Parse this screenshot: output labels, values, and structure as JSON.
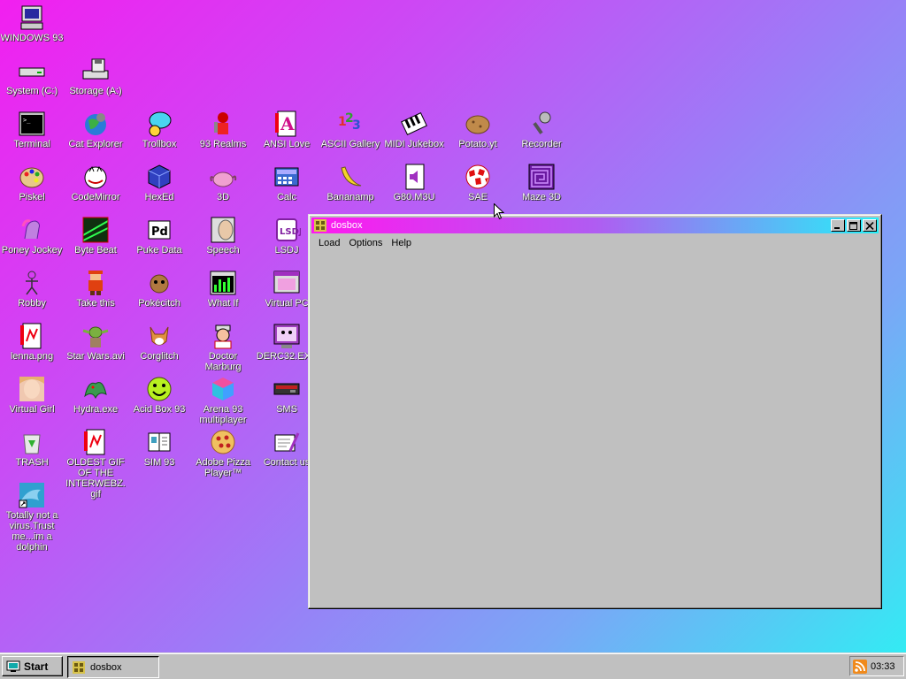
{
  "desktop_icons": [
    {
      "id": "win93",
      "label": "WINDOWS 93",
      "icon": "computer-icon"
    },
    {
      "id": "sysc",
      "label": "System (C:)",
      "icon": "hard-drive-icon"
    },
    {
      "id": "stora",
      "label": "Storage (A:)",
      "icon": "floppy-drive-icon"
    },
    {
      "id": "terminal",
      "label": "Terminal",
      "icon": "terminal-icon"
    },
    {
      "id": "catexp",
      "label": "Cat Explorer",
      "icon": "globe-cat-icon"
    },
    {
      "id": "trollbox",
      "label": "Trollbox",
      "icon": "chat-bubble-icon"
    },
    {
      "id": "realms",
      "label": "93 Realms",
      "icon": "knight-icon"
    },
    {
      "id": "ansi",
      "label": "ANSI Love",
      "icon": "letter-a-icon"
    },
    {
      "id": "ascii",
      "label": "ASCII Gallery",
      "icon": "numbers-icon"
    },
    {
      "id": "midi",
      "label": "MIDI Jukebox",
      "icon": "piano-keys-icon"
    },
    {
      "id": "potato",
      "label": "Potato.yt",
      "icon": "potato-icon"
    },
    {
      "id": "recorder",
      "label": "Recorder",
      "icon": "microphone-icon"
    },
    {
      "id": "piskel",
      "label": "Piskel",
      "icon": "palette-icon"
    },
    {
      "id": "codemirror",
      "label": "CodeMirror",
      "icon": "cat-code-icon"
    },
    {
      "id": "hexed",
      "label": "HexEd",
      "icon": "cube-icon"
    },
    {
      "id": "threed",
      "label": "3D",
      "icon": "teapot-icon"
    },
    {
      "id": "calc",
      "label": "Calc",
      "icon": "calculator-icon"
    },
    {
      "id": "bananamp",
      "label": "Bananamp",
      "icon": "banana-icon"
    },
    {
      "id": "g80",
      "label": "G80.M3U",
      "icon": "speaker-file-icon"
    },
    {
      "id": "sae",
      "label": "SAE",
      "icon": "checkered-ball-icon"
    },
    {
      "id": "maze",
      "label": "Maze 3D",
      "icon": "maze-icon"
    },
    {
      "id": "poney",
      "label": "Poney Jockey",
      "icon": "pony-icon"
    },
    {
      "id": "bytebeat",
      "label": "Byte Beat",
      "icon": "waveform-icon"
    },
    {
      "id": "puke",
      "label": "Puke Data",
      "icon": "pd-icon"
    },
    {
      "id": "speech",
      "label": "Speech",
      "icon": "face-speech-icon"
    },
    {
      "id": "lsdj",
      "label": "LSDJ",
      "icon": "lsdj-icon"
    },
    {
      "id": "robby",
      "label": "Robby",
      "icon": "stick-figure-icon"
    },
    {
      "id": "takethis",
      "label": "Take this",
      "icon": "pixel-character-icon"
    },
    {
      "id": "pokecitch",
      "label": "Pokécitch",
      "icon": "pokemon-icon"
    },
    {
      "id": "whatif",
      "label": "What If",
      "icon": "equalizer-window-icon"
    },
    {
      "id": "virtualpc",
      "label": "Virtual PC",
      "icon": "window-pc-icon"
    },
    {
      "id": "lenna",
      "label": "lenna.png",
      "icon": "image-file-icon"
    },
    {
      "id": "starwars",
      "label": "Star Wars.avi",
      "icon": "yoda-icon"
    },
    {
      "id": "corglitch",
      "label": "Corglitch",
      "icon": "corgi-icon"
    },
    {
      "id": "doctor",
      "label": "Doctor Marburg",
      "icon": "doctor-icon"
    },
    {
      "id": "derc",
      "label": "DERC32.EXE",
      "icon": "monitor-face-icon"
    },
    {
      "id": "virtualgirl",
      "label": "Virtual Girl",
      "icon": "portrait-icon"
    },
    {
      "id": "hydra",
      "label": "Hydra.exe",
      "icon": "dragon-icon"
    },
    {
      "id": "acidbox",
      "label": "Acid Box 93",
      "icon": "smiley-icon"
    },
    {
      "id": "arena",
      "label": "Arena 93 multiplayer",
      "icon": "color-cube-icon"
    },
    {
      "id": "sms",
      "label": "SMS",
      "icon": "console-icon"
    },
    {
      "id": "trash",
      "label": "TRASH",
      "icon": "recycle-bin-icon"
    },
    {
      "id": "oldestgif",
      "label": "OLDEST GIF OF THE INTERWEBZ.gif",
      "icon": "image-file-icon"
    },
    {
      "id": "sim93",
      "label": "SIM 93",
      "icon": "book-icon"
    },
    {
      "id": "pizza",
      "label": "Adobe Pizza Player™",
      "icon": "pizza-icon"
    },
    {
      "id": "contact",
      "label": "Contact us",
      "icon": "message-pen-icon"
    },
    {
      "id": "dolphin",
      "label": "Totally not a virus.Trust me...im a dolphin",
      "icon": "dolphin-shortcut-icon"
    }
  ],
  "window": {
    "title": "dosbox",
    "icon": "dosbox-icon",
    "menu": [
      "Load",
      "Options",
      "Help"
    ],
    "buttons": [
      "minimize",
      "maximize",
      "close"
    ]
  },
  "taskbar": {
    "start_label": "Start",
    "tasks": [
      {
        "label": "dosbox",
        "icon": "dosbox-icon"
      }
    ],
    "clock": "03:33",
    "tray_icon": "rss-icon"
  },
  "colors": {
    "bg_start": "#f21ff0",
    "bg_end": "#2ef0f3",
    "window_face": "#c0c0c0"
  }
}
